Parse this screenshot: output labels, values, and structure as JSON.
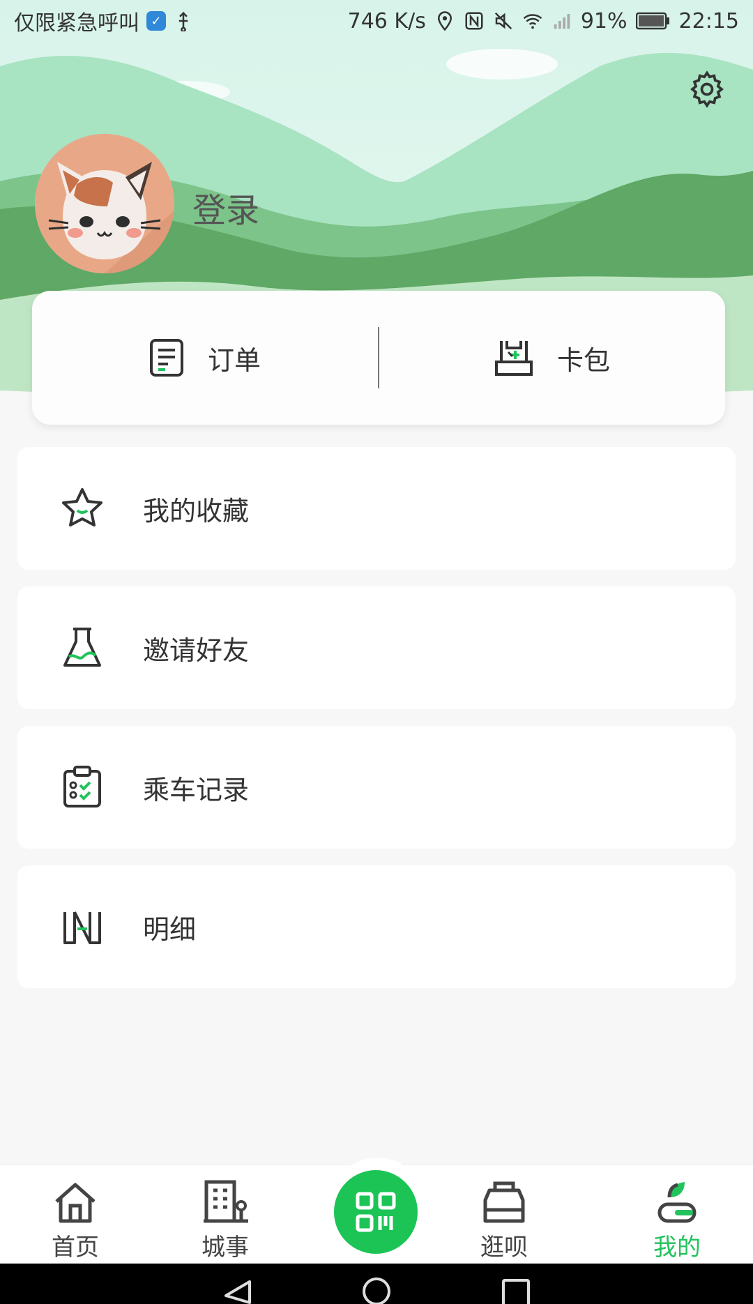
{
  "status_bar": {
    "carrier_text": "仅限紧急呼叫",
    "network_speed": "746 K/s",
    "battery_percent": "91%",
    "time": "22:15"
  },
  "header": {
    "login_label": "登录"
  },
  "quick_actions": [
    {
      "label": "订单",
      "icon": "order-icon"
    },
    {
      "label": "卡包",
      "icon": "card-wallet-icon"
    }
  ],
  "menu": [
    {
      "label": "我的收藏",
      "icon": "star-icon"
    },
    {
      "label": "邀请好友",
      "icon": "flask-icon"
    },
    {
      "label": "乘车记录",
      "icon": "clipboard-check-icon"
    },
    {
      "label": "明细",
      "icon": "ledger-icon"
    }
  ],
  "bottom_nav": [
    {
      "label": "首页",
      "icon": "home-icon",
      "active": false
    },
    {
      "label": "城事",
      "icon": "city-icon",
      "active": false
    },
    {
      "label": "",
      "icon": "qr-scan-icon",
      "active": false
    },
    {
      "label": "逛呗",
      "icon": "shop-icon",
      "active": false
    },
    {
      "label": "我的",
      "icon": "profile-icon",
      "active": true
    }
  ],
  "colors": {
    "accent": "#1cc456",
    "active_label": "#22c25c"
  }
}
